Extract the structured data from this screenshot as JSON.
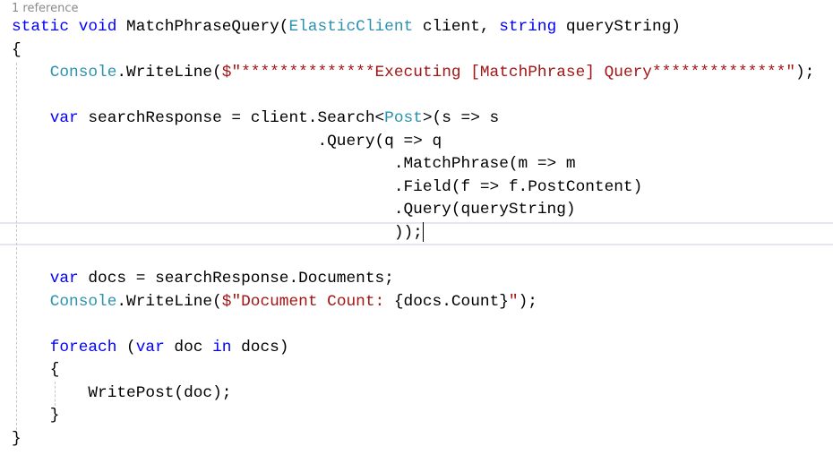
{
  "codelens": "1 reference",
  "colors": {
    "keyword": "#0000ff",
    "type": "#2b91af",
    "string": "#a31515",
    "plain": "#000000"
  },
  "lines": [
    {
      "indent": 0,
      "tokens": [
        [
          "kw",
          "static void "
        ],
        [
          "pl",
          "MatchPhraseQuery("
        ],
        [
          "ty",
          "ElasticClient"
        ],
        [
          "pl",
          " client, "
        ],
        [
          "kw",
          "string"
        ],
        [
          "pl",
          " queryString)"
        ]
      ]
    },
    {
      "indent": 0,
      "tokens": [
        [
          "pl",
          "{"
        ]
      ]
    },
    {
      "indent": 4,
      "tokens": [
        [
          "ty",
          "Console"
        ],
        [
          "pl",
          ".WriteLine("
        ],
        [
          "st",
          "$\"**************Executing [MatchPhrase] Query**************\""
        ],
        [
          "pl",
          ");"
        ]
      ]
    },
    {
      "indent": 0,
      "tokens": []
    },
    {
      "indent": 4,
      "tokens": [
        [
          "kw",
          "var"
        ],
        [
          "pl",
          " searchResponse = client.Search<"
        ],
        [
          "ty",
          "Post"
        ],
        [
          "pl",
          ">(s => s"
        ]
      ]
    },
    {
      "indent": 32,
      "tokens": [
        [
          "pl",
          ".Query(q => q"
        ]
      ]
    },
    {
      "indent": 40,
      "tokens": [
        [
          "pl",
          ".MatchPhrase(m => m"
        ]
      ]
    },
    {
      "indent": 40,
      "tokens": [
        [
          "pl",
          ".Field(f => f.PostContent)"
        ]
      ]
    },
    {
      "indent": 40,
      "tokens": [
        [
          "pl",
          ".Query(queryString)"
        ]
      ]
    },
    {
      "indent": 40,
      "tokens": [
        [
          "pl",
          "));"
        ]
      ],
      "caret": true
    },
    {
      "indent": 0,
      "tokens": []
    },
    {
      "indent": 4,
      "tokens": [
        [
          "kw",
          "var"
        ],
        [
          "pl",
          " docs = searchResponse.Documents;"
        ]
      ]
    },
    {
      "indent": 4,
      "tokens": [
        [
          "ty",
          "Console"
        ],
        [
          "pl",
          ".WriteLine("
        ],
        [
          "st",
          "$\"Document Count: "
        ],
        [
          "pl",
          "{docs.Count}"
        ],
        [
          "st",
          "\""
        ],
        [
          "pl",
          ");"
        ]
      ]
    },
    {
      "indent": 0,
      "tokens": []
    },
    {
      "indent": 4,
      "tokens": [
        [
          "kw",
          "foreach"
        ],
        [
          "pl",
          " ("
        ],
        [
          "kw",
          "var"
        ],
        [
          "pl",
          " doc "
        ],
        [
          "kw",
          "in"
        ],
        [
          "pl",
          " docs)"
        ]
      ]
    },
    {
      "indent": 4,
      "tokens": [
        [
          "pl",
          "{"
        ]
      ]
    },
    {
      "indent": 8,
      "tokens": [
        [
          "pl",
          "WritePost(doc);"
        ]
      ]
    },
    {
      "indent": 4,
      "tokens": [
        [
          "pl",
          "}"
        ]
      ]
    },
    {
      "indent": 0,
      "tokens": [
        [
          "pl",
          "}"
        ]
      ]
    }
  ]
}
